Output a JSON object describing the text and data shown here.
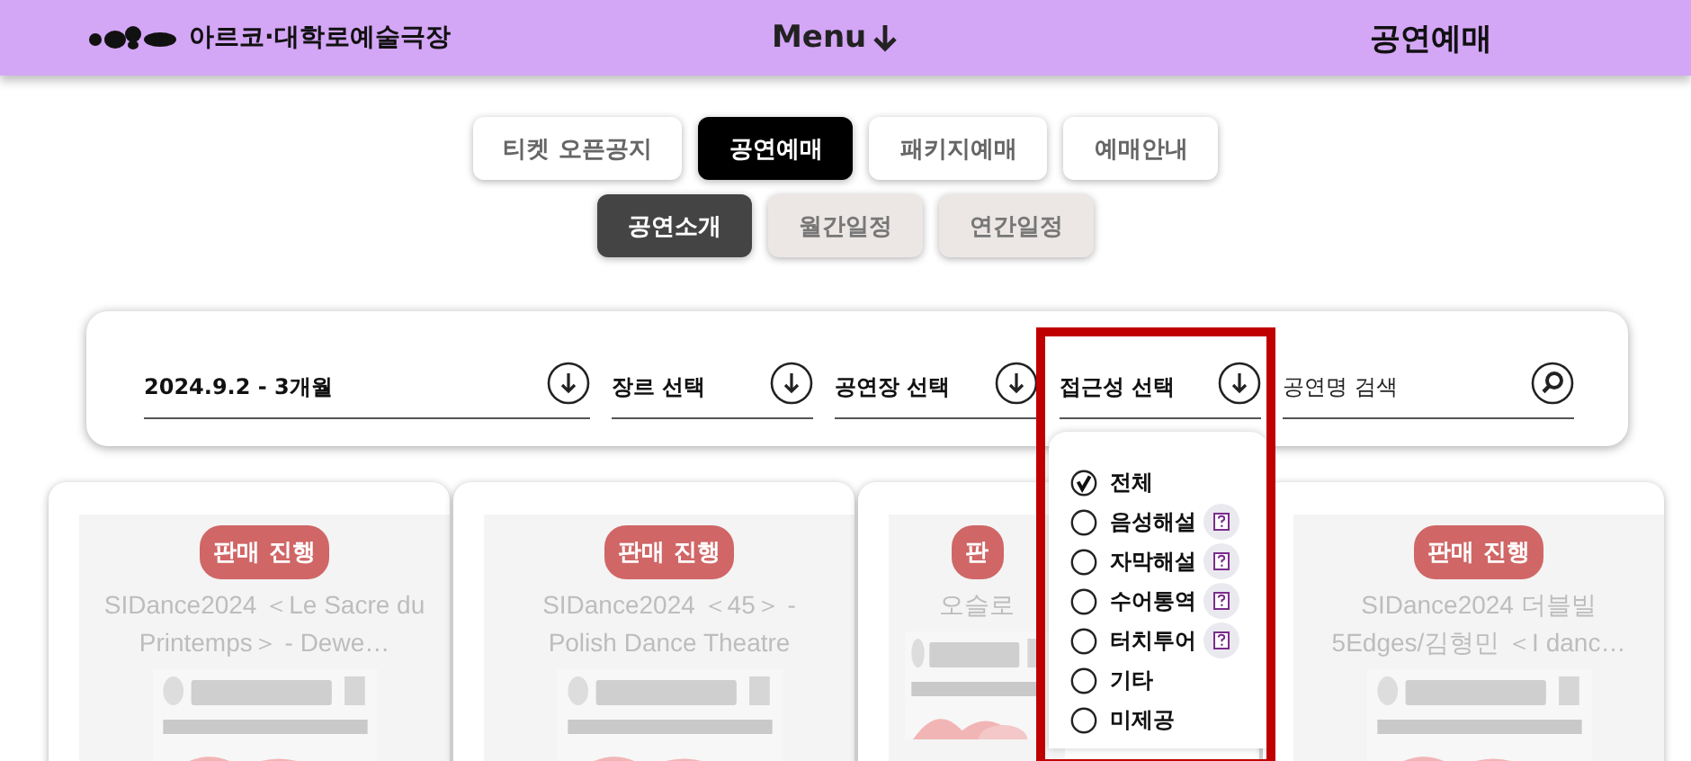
{
  "header": {
    "logo_text": "아르코·대학로예술극장",
    "menu": "Menu",
    "title": "공연예매"
  },
  "tabs": [
    {
      "label": "티켓 오픈공지",
      "selected": false
    },
    {
      "label": "공연예매",
      "selected": true
    },
    {
      "label": "패키지예매",
      "selected": false
    },
    {
      "label": "예매안내",
      "selected": false
    }
  ],
  "subtabs": [
    {
      "label": "공연소개",
      "selected": true
    },
    {
      "label": "월간일정",
      "selected": false
    },
    {
      "label": "연간일정",
      "selected": false
    }
  ],
  "filters": [
    {
      "kind": "select",
      "label": "2024.9.2 - 3개월"
    },
    {
      "kind": "select",
      "label": "장르 선택"
    },
    {
      "kind": "select",
      "label": "공연장 선택"
    },
    {
      "kind": "select",
      "label": "접근성 선택"
    },
    {
      "kind": "search",
      "placeholder": "공연명 검색"
    }
  ],
  "dropdown": {
    "items": [
      {
        "label": "전체",
        "selected": true,
        "info": false
      },
      {
        "label": "음성해설",
        "selected": false,
        "info": true
      },
      {
        "label": "자막해설",
        "selected": false,
        "info": true
      },
      {
        "label": "수어통역",
        "selected": false,
        "info": true
      },
      {
        "label": "터치투어",
        "selected": false,
        "info": true
      },
      {
        "label": "기타",
        "selected": false,
        "info": false
      },
      {
        "label": "미제공",
        "selected": false,
        "info": false
      }
    ]
  },
  "cards": [
    {
      "badge": "판매 진행",
      "title": "SIDance2024 ＜Le Sacre du Printemps＞ - Dewe…",
      "covered": false
    },
    {
      "badge": "판매 진행",
      "title": "SIDance2024 ＜45＞ - Polish Dance Theatre",
      "covered": false
    },
    {
      "badge": "판",
      "title": "오슬로",
      "covered": true
    },
    {
      "badge": "판매 진행",
      "title": "SIDance2024 더블빌 5Edges/김형민 ＜I danc…",
      "covered": false
    }
  ]
}
